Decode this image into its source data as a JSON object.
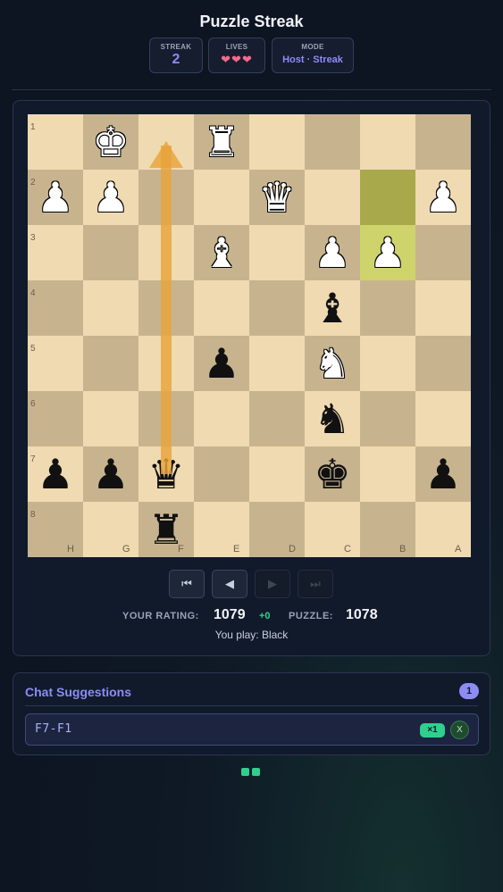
{
  "header": {
    "title": "Puzzle Streak",
    "streak_label": "STREAK",
    "streak_value": "2",
    "lives_label": "LIVES",
    "lives_value": "❤❤❤",
    "mode_label": "MODE",
    "mode_value": "Host · Streak"
  },
  "board": {
    "ranks": [
      "1",
      "2",
      "3",
      "4",
      "5",
      "6",
      "7",
      "8"
    ],
    "files": [
      "H",
      "G",
      "F",
      "E",
      "D",
      "C",
      "B",
      "A"
    ],
    "pieces": [
      {
        "square": "g1",
        "glyph": "♚",
        "color": "white",
        "name": "white-king"
      },
      {
        "square": "e1",
        "glyph": "♜",
        "color": "white",
        "name": "white-rook"
      },
      {
        "square": "h2",
        "glyph": "♟",
        "color": "white",
        "name": "white-pawn"
      },
      {
        "square": "g2",
        "glyph": "♟",
        "color": "white",
        "name": "white-pawn"
      },
      {
        "square": "d2",
        "glyph": "♛",
        "color": "white",
        "name": "white-queen"
      },
      {
        "square": "a2",
        "glyph": "♟",
        "color": "white",
        "name": "white-pawn"
      },
      {
        "square": "e3",
        "glyph": "♝",
        "color": "white",
        "name": "white-bishop"
      },
      {
        "square": "c3",
        "glyph": "♟",
        "color": "white",
        "name": "white-pawn"
      },
      {
        "square": "b3",
        "glyph": "♟",
        "color": "white",
        "name": "white-pawn"
      },
      {
        "square": "c4",
        "glyph": "♝",
        "color": "black",
        "name": "black-bishop"
      },
      {
        "square": "e5",
        "glyph": "♟",
        "color": "black",
        "name": "black-pawn"
      },
      {
        "square": "c5",
        "glyph": "♞",
        "color": "white",
        "name": "white-knight"
      },
      {
        "square": "c6",
        "glyph": "♞",
        "color": "black",
        "name": "black-knight"
      },
      {
        "square": "h7",
        "glyph": "♟",
        "color": "black",
        "name": "black-pawn"
      },
      {
        "square": "g7",
        "glyph": "♟",
        "color": "black",
        "name": "black-pawn"
      },
      {
        "square": "f7",
        "glyph": "♛",
        "color": "black",
        "name": "black-queen"
      },
      {
        "square": "c7",
        "glyph": "♚",
        "color": "black",
        "name": "black-king"
      },
      {
        "square": "a7",
        "glyph": "♟",
        "color": "black",
        "name": "black-pawn"
      },
      {
        "square": "f8",
        "glyph": "♜",
        "color": "black",
        "name": "black-rook"
      }
    ],
    "last_move": [
      "b2",
      "b3"
    ],
    "arrow": {
      "from": "f7",
      "to": "f1",
      "color": "#e8a33a"
    }
  },
  "controls": {
    "first": "⏮",
    "prev": "◀",
    "next": "▶",
    "last": "⏭"
  },
  "rating": {
    "your_label": "YOUR RATING:",
    "your_value": "1079",
    "delta": "+0",
    "puzzle_label": "PUZZLE:",
    "puzzle_value": "1078",
    "you_play": "You play: Black"
  },
  "chat": {
    "title": "Chat Suggestions",
    "count": "1",
    "suggestions": [
      {
        "move": "F7-F1",
        "votes": "×1",
        "close": "X"
      }
    ]
  },
  "colors": {
    "accent": "#8e8bf5",
    "success": "#2fcf8d",
    "arrow": "#e8a33a"
  }
}
